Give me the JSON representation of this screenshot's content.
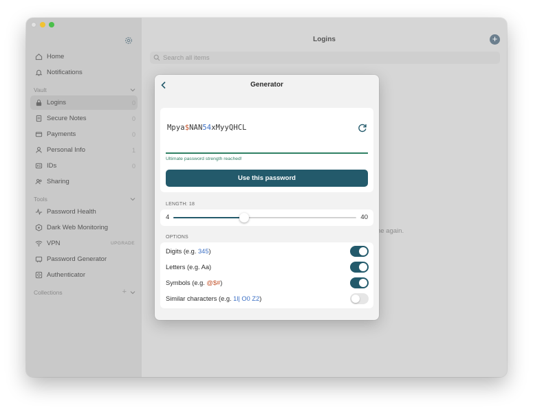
{
  "sidebar": {
    "items_top": [
      {
        "label": "Home",
        "icon": "home-icon"
      },
      {
        "label": "Notifications",
        "icon": "bell-icon"
      }
    ],
    "vault_header": "Vault",
    "vault_items": [
      {
        "label": "Logins",
        "count": "0",
        "icon": "lock-icon"
      },
      {
        "label": "Secure Notes",
        "count": "0",
        "icon": "note-icon"
      },
      {
        "label": "Payments",
        "count": "0",
        "icon": "card-icon"
      },
      {
        "label": "Personal Info",
        "count": "1",
        "icon": "person-icon"
      },
      {
        "label": "IDs",
        "count": "0",
        "icon": "id-icon"
      },
      {
        "label": "Sharing",
        "icon": "share-icon"
      }
    ],
    "tools_header": "Tools",
    "tools_items": [
      {
        "label": "Password Health",
        "icon": "pulse-icon"
      },
      {
        "label": "Dark Web Monitoring",
        "icon": "radar-icon"
      },
      {
        "label": "VPN",
        "icon": "wifi-icon",
        "badge": "UPGRADE"
      },
      {
        "label": "Password Generator",
        "icon": "generator-icon"
      },
      {
        "label": "Authenticator",
        "icon": "authenticator-icon"
      }
    ],
    "collections_header": "Collections"
  },
  "main": {
    "title": "Logins",
    "search_placeholder": "Search all items",
    "background_text": "ne again."
  },
  "generator": {
    "title": "Generator",
    "password_parts": [
      {
        "text": "Mpya",
        "kind": "letter"
      },
      {
        "text": "$",
        "kind": "symbol"
      },
      {
        "text": "NAN",
        "kind": "letter"
      },
      {
        "text": "54",
        "kind": "digit"
      },
      {
        "text": "xMyyQHCL",
        "kind": "letter"
      }
    ],
    "strength_text": "Ultimate password strength reached!",
    "use_button": "Use this password",
    "length_label": "LENGTH: 18",
    "length": {
      "min": 4,
      "max": 40,
      "value": 18
    },
    "min_label": "4",
    "max_label": "40",
    "options_label": "OPTIONS",
    "options": [
      {
        "pre": "Digits (e.g. ",
        "example": "345",
        "post": ")",
        "example_kind": "digit",
        "enabled": true
      },
      {
        "pre": "Letters (e.g. Aa)",
        "example": "",
        "post": "",
        "example_kind": "none",
        "enabled": true
      },
      {
        "pre": "Symbols (e.g. ",
        "example": "@$#",
        "post": ")",
        "example_kind": "symbol",
        "enabled": true
      },
      {
        "pre": "Similar characters (e.g. ",
        "example": "1l| O0 Z2",
        "post": ")",
        "example_kind": "digit",
        "enabled": false
      }
    ]
  },
  "colors": {
    "accent": "#235a6b",
    "strength": "#2e7f63",
    "symbol": "#c4532b",
    "digit": "#3b6fc4"
  }
}
